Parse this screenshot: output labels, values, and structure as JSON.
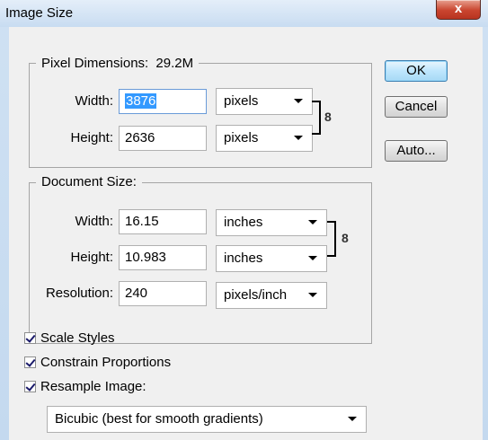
{
  "window": {
    "title": "Image Size",
    "close_glyph": "x"
  },
  "pixel_dimensions": {
    "legend": "Pixel Dimensions:",
    "size_value": "29.2M",
    "width_label": "Width:",
    "width_value": "3876",
    "width_unit": "pixels",
    "height_label": "Height:",
    "height_value": "2636",
    "height_unit": "pixels"
  },
  "document_size": {
    "legend": "Document Size:",
    "width_label": "Width:",
    "width_value": "16.15",
    "width_unit": "inches",
    "height_label": "Height:",
    "height_value": "10.983",
    "height_unit": "inches",
    "resolution_label": "Resolution:",
    "resolution_value": "240",
    "resolution_unit": "pixels/inch"
  },
  "buttons": {
    "ok": "OK",
    "cancel": "Cancel",
    "auto": "Auto..."
  },
  "options": {
    "scale_styles": "Scale Styles",
    "scale_styles_checked": true,
    "constrain_proportions": "Constrain Proportions",
    "constrain_proportions_checked": true,
    "resample_image": "Resample Image:",
    "resample_image_checked": true,
    "resample_method": "Bicubic (best for smooth gradients)"
  },
  "icons": {
    "link": "chain-link-icon"
  }
}
